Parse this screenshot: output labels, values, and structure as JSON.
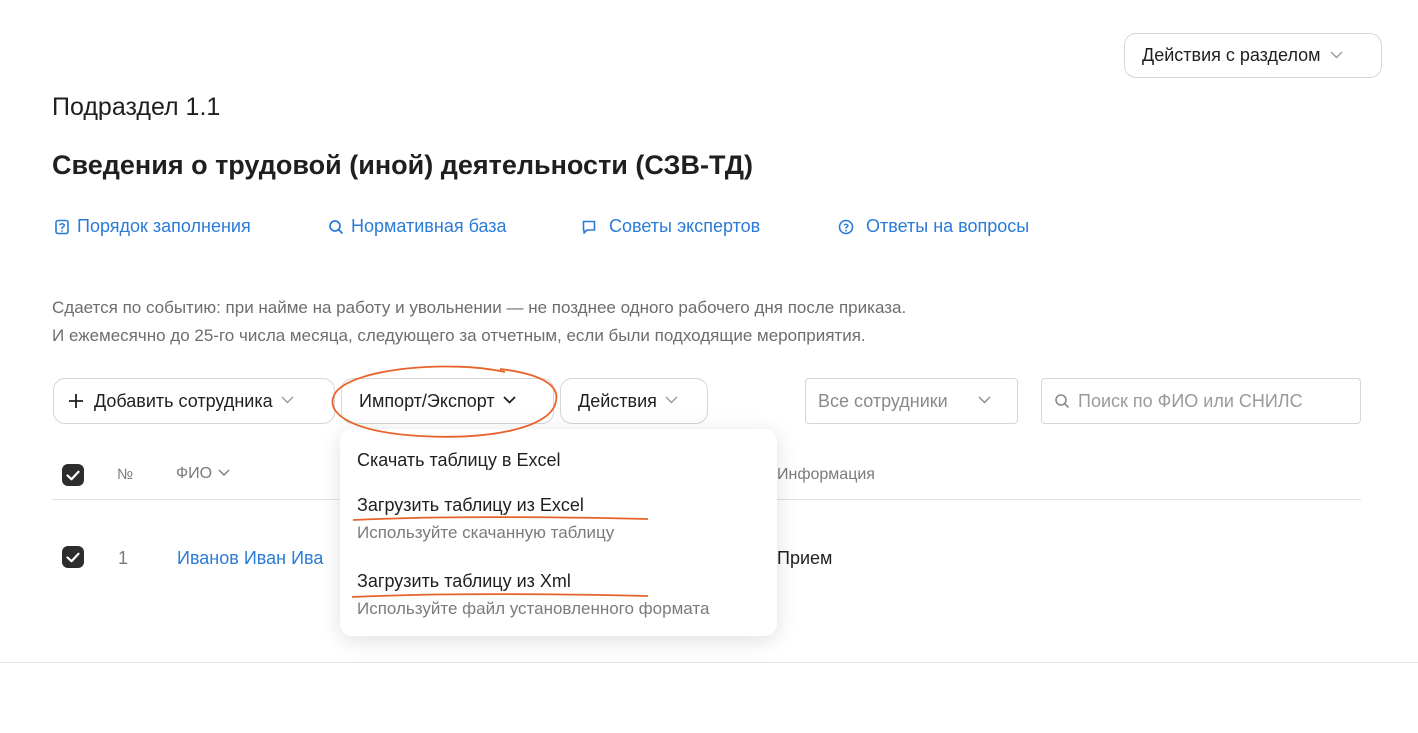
{
  "header": {
    "section_actions_label": "Действия с разделом",
    "subsection": "Подраздел 1.1",
    "title": "Сведения о трудовой (иной) деятельности (СЗВ-ТД)"
  },
  "links": {
    "fill_order": "Порядок заполнения",
    "normative_base": "Нормативная база",
    "expert_tips": "Советы экспертов",
    "faq": "Ответы на вопросы"
  },
  "description": {
    "line1": "Сдается по событию: при найме на работу и увольнении — не позднее одного рабочего дня после приказа.",
    "line2": "И ежемесячно до 25-го числа месяца, следующего за отчетным, если были подходящие мероприятия."
  },
  "toolbar": {
    "add_employee": "Добавить сотрудника",
    "import_export": "Импорт/Экспорт",
    "actions": "Действия",
    "filter_value": "Все сотрудники",
    "search_placeholder": "Поиск по ФИО или СНИЛС"
  },
  "table": {
    "columns": {
      "number": "№",
      "name": "ФИО",
      "info": "Информация"
    },
    "rows": [
      {
        "number": "1",
        "name": "Иванов Иван Ива",
        "info": "Прием",
        "checked": true
      }
    ]
  },
  "dropdown": {
    "items": [
      {
        "label": "Скачать таблицу в Excel",
        "sub": ""
      },
      {
        "label": "Загрузить таблицу из Excel",
        "sub": "Используйте скачанную таблицу"
      },
      {
        "label": "Загрузить таблицу из Xml",
        "sub": "Используйте файл установленного формата"
      }
    ]
  },
  "colors": {
    "link": "#2a7bd8",
    "annotation": "#e8632b",
    "checkbox": "#2d2d2d"
  }
}
